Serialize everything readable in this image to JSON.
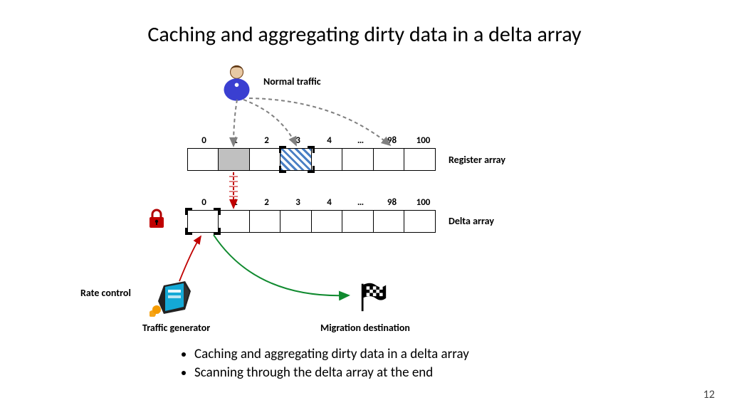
{
  "title": "Caching and aggregating dirty data in a delta array",
  "labels": {
    "normal_traffic": "Normal traffic",
    "register_array": "Register array",
    "delta_array": "Delta array",
    "rate_control": "Rate control",
    "traffic_generator": "Traffic generator",
    "migration_destination": "Migration destination"
  },
  "indices": [
    "0",
    "1",
    "2",
    "3",
    "4",
    "…",
    "98",
    "100"
  ],
  "bullets": {
    "b1": "Caching and aggregating dirty data in a delta array",
    "b2": "Scanning through the delta array at the end"
  },
  "slide_number": "12",
  "chart_data": {
    "type": "diagram",
    "arrays": {
      "register_array": {
        "cells": 8,
        "index_labels": [
          "0",
          "1",
          "2",
          "3",
          "4",
          "…",
          "98",
          "100"
        ],
        "highlighted_gray": [
          1
        ],
        "highlighted_hatched": [
          3
        ],
        "selected_brackets": [
          3
        ]
      },
      "delta_array": {
        "cells": 8,
        "index_labels": [
          "0",
          "1",
          "2",
          "3",
          "4",
          "…",
          "98",
          "100"
        ],
        "selected_brackets": [
          0
        ],
        "lock": true
      }
    },
    "arrows": [
      {
        "from": "normal_traffic",
        "to": "register_array[1,3,6]",
        "style": "dashed-gray"
      },
      {
        "from": "register_array[1]",
        "to": "delta_array[1]",
        "style": "dashed-red"
      },
      {
        "from": "traffic_generator",
        "to": "delta_array[0]",
        "style": "solid-red"
      },
      {
        "from": "delta_array",
        "to": "migration_destination",
        "style": "solid-green"
      }
    ]
  }
}
